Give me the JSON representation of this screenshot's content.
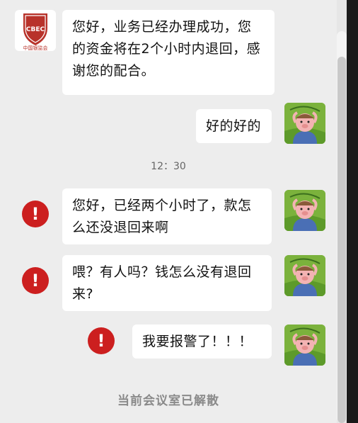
{
  "sender": {
    "logo_text": "CBEC",
    "logo_caption": "中国银监会",
    "message": "您好，业务已经办理成功，您的资金将在2个小时内退回，感谢您的配合。"
  },
  "user_messages": [
    "好的好的",
    "您好，已经两个小时了，款怎么还没退回来啊",
    "喂？有人吗？钱怎么没有退回来?",
    "我要报警了！！！"
  ],
  "timestamp": "12：30",
  "status": {
    "alert_symbol": "!",
    "footer": "当前会议室已解散"
  },
  "colors": {
    "alert": "#cc1f1f",
    "avatar_bg": "#7bb23c",
    "chat_bg": "#ededed"
  },
  "icons": {
    "sender_avatar": "cbrc-shield-logo",
    "user_avatar": "cartoon-pig-avatar",
    "failed_send": "exclamation-alert-icon"
  }
}
